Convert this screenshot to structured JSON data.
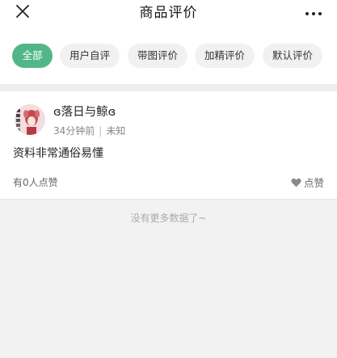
{
  "header": {
    "title": "商品评价",
    "close_icon": "close-icon",
    "more_icon": "more-icon"
  },
  "filters": [
    {
      "label": "全部",
      "active": true
    },
    {
      "label": "用户自评",
      "active": false
    },
    {
      "label": "带图评价",
      "active": false
    },
    {
      "label": "加精评价",
      "active": false
    },
    {
      "label": "默认评价",
      "active": false
    }
  ],
  "review": {
    "username": "ɞ落日与鲸ɞ",
    "time": "34分钟前",
    "spec": "未知",
    "text": "资料非常通俗易懂",
    "likes_label": "有0人点赞",
    "like_button": "点赞"
  },
  "footer": {
    "note": "没有更多数据了~"
  },
  "colors": {
    "accent": "#52b788",
    "chip_bg": "#f1f1f1",
    "page_bg": "#f2f2f2"
  }
}
